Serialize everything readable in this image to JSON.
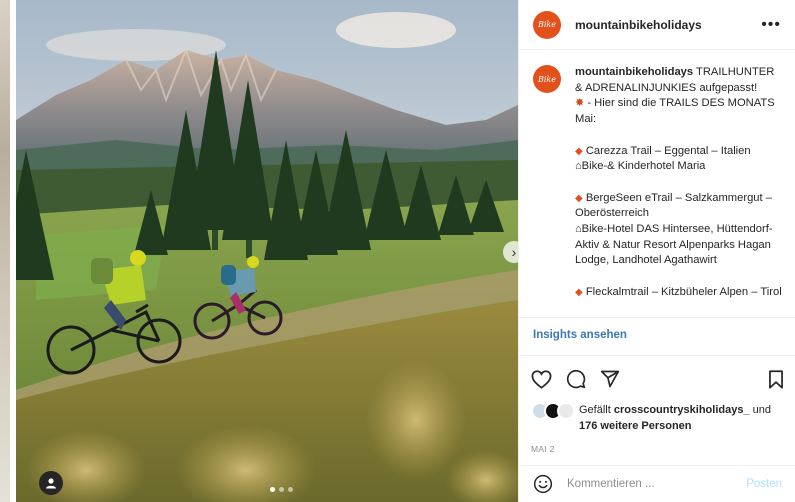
{
  "account": {
    "username": "mountainbikeholidays",
    "avatar_text": "Bike"
  },
  "media": {
    "slide_count": 3,
    "active_slide": 1,
    "next_icon": "chevron-right-icon",
    "tag_icon": "user-tag-icon"
  },
  "caption": {
    "username": "mountainbikeholidays",
    "line1": "TRAILHUNTER & ADRENALINJUNKIES aufgepasst!",
    "line2": " - Hier sind die TRAILS DES MONATS Mai:",
    "trail1_name": "Carezza Trail – Eggental – Italien",
    "trail1_hotel": "Bike-& Kinderhotel Maria",
    "trail2_name": "BergeSeen eTrail – Salzkammergut – Oberösterreich",
    "trail2_hotel": "Bike-Hotel DAS Hintersee, Hüttendorf- Aktiv & Natur Resort Alpenparks Hagan Lodge, Landhotel Agathawirt",
    "trail3_name": "Fleckalmtrail – Kitzbüheler Alpen – Tirol"
  },
  "insights_label": "Insights ansehen",
  "likes": {
    "prefix": "Gefällt ",
    "user": "crosscountryskiholidays_",
    "middle": " und ",
    "others": "176 weitere Personen"
  },
  "date": "MAI 2",
  "comment": {
    "placeholder": "Kommentieren ...",
    "post_label": "Posten"
  },
  "colors": {
    "brand": "#e2501c",
    "link": "#3b78b8",
    "post_disabled": "#b2dffc"
  }
}
